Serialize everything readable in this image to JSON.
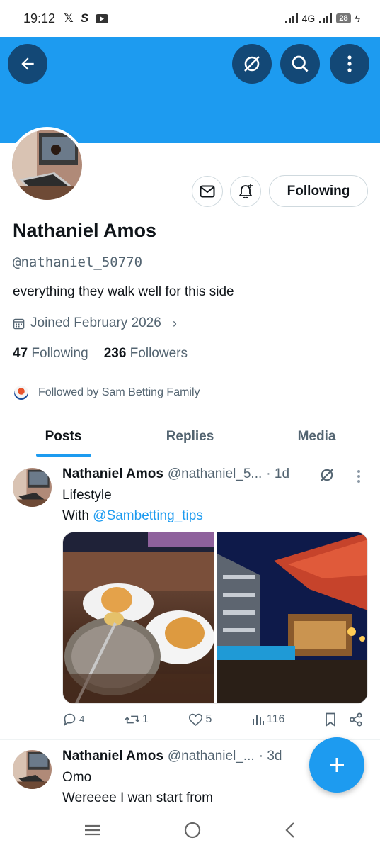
{
  "status_bar": {
    "time": "19:12",
    "left_icons": [
      "x-logo-icon",
      "sportybet-icon",
      "youtube-icon"
    ],
    "network": "4G",
    "battery": "28"
  },
  "header": {
    "banner_color": "#1d9bf0",
    "buttons": [
      "back-arrow-icon",
      "grok-icon",
      "search-icon",
      "more-vertical-icon"
    ]
  },
  "profile": {
    "name": "Nathaniel Amos",
    "handle": "@nathaniel_50770",
    "bio": "everything they walk well for this side",
    "joined": "Joined February 2026",
    "following_count": "47",
    "following_label": "Following",
    "followers_count": "236",
    "followers_label": "Followers",
    "followed_by": "Followed by Sam Betting Family",
    "follow_button": "Following"
  },
  "tabs": [
    {
      "label": "Posts",
      "active": true
    },
    {
      "label": "Replies",
      "active": false
    },
    {
      "label": "Media",
      "active": false
    }
  ],
  "posts": [
    {
      "name": "Nathaniel Amos",
      "handle": "@nathaniel_5...",
      "time": "· 1d",
      "line1": "Lifestyle",
      "line2_prefix": "With ",
      "mention": "@Sambetting_tips",
      "stats": {
        "replies": "4",
        "reposts": "1",
        "likes": "5",
        "views": "116"
      }
    },
    {
      "name": "Nathaniel Amos",
      "handle": "@nathaniel_...",
      "time": "· 3d",
      "line1": "Omo",
      "line2": "Wereeee I wan start from"
    }
  ],
  "colors": {
    "accent": "#1d9bf0",
    "secondary_text": "#536471"
  }
}
